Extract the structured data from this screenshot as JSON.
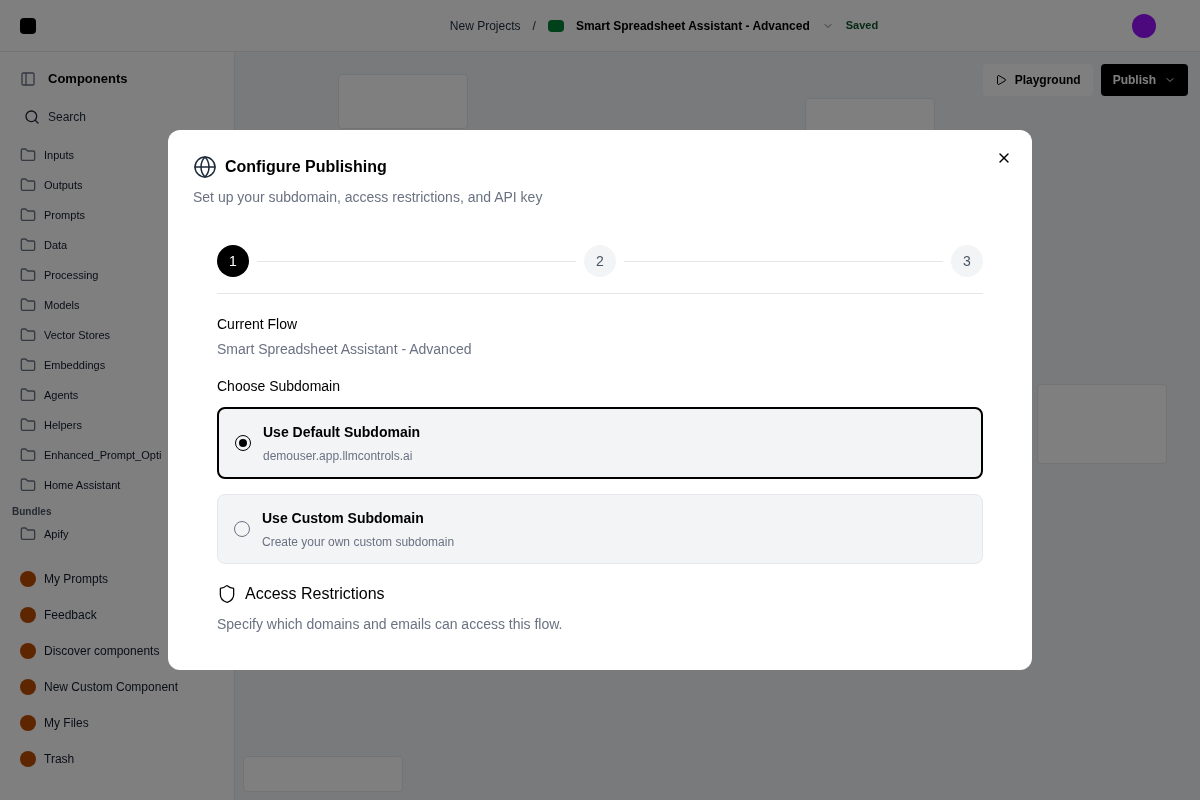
{
  "header": {
    "breadcrumb": "New Projects",
    "separator": "/",
    "flow_name": "Smart Spreadsheet Assistant - Advanced",
    "status": "Saved"
  },
  "sidebar": {
    "title": "Components",
    "search": {
      "placeholder": "Search"
    },
    "items": [
      {
        "label": "Inputs"
      },
      {
        "label": "Outputs"
      },
      {
        "label": "Prompts"
      },
      {
        "label": "Data"
      },
      {
        "label": "Processing"
      },
      {
        "label": "Models"
      },
      {
        "label": "Vector Stores"
      },
      {
        "label": "Embeddings"
      },
      {
        "label": "Agents"
      },
      {
        "label": "Helpers"
      },
      {
        "label": "Enhanced_Prompt_Opti"
      },
      {
        "label": "Home Assistant"
      }
    ],
    "section_title": "Bundles",
    "bundles": [
      {
        "label": "Apify"
      }
    ],
    "footer_items": [
      {
        "label": "My Prompts"
      },
      {
        "label": "Feedback"
      },
      {
        "label": "Discover components"
      },
      {
        "label": "New Custom Component"
      },
      {
        "label": "My Files"
      },
      {
        "label": "Trash"
      }
    ]
  },
  "toolbar": {
    "playground": "Playground",
    "publish": "Publish"
  },
  "dialog": {
    "title": "Configure Publishing",
    "subtitle": "Set up your subdomain, access restrictions, and API key",
    "steps": [
      {
        "label": "1",
        "selected": true
      },
      {
        "label": "2",
        "selected": false
      },
      {
        "label": "3",
        "selected": false
      }
    ],
    "current_flow_label": "Current Flow",
    "current_flow_value": "Smart Spreadsheet Assistant - Advanced",
    "choose_label": "Choose Subdomain",
    "options": [
      {
        "title": "Use Default Subdomain",
        "description": "demouser.app.llmcontrols.ai",
        "selected": true
      },
      {
        "title": "Use Custom Subdomain",
        "description": "Create your own custom subdomain",
        "selected": false
      }
    ],
    "access_title": "Access Restrictions",
    "access_description": "Specify which domains and emails can access this flow."
  }
}
